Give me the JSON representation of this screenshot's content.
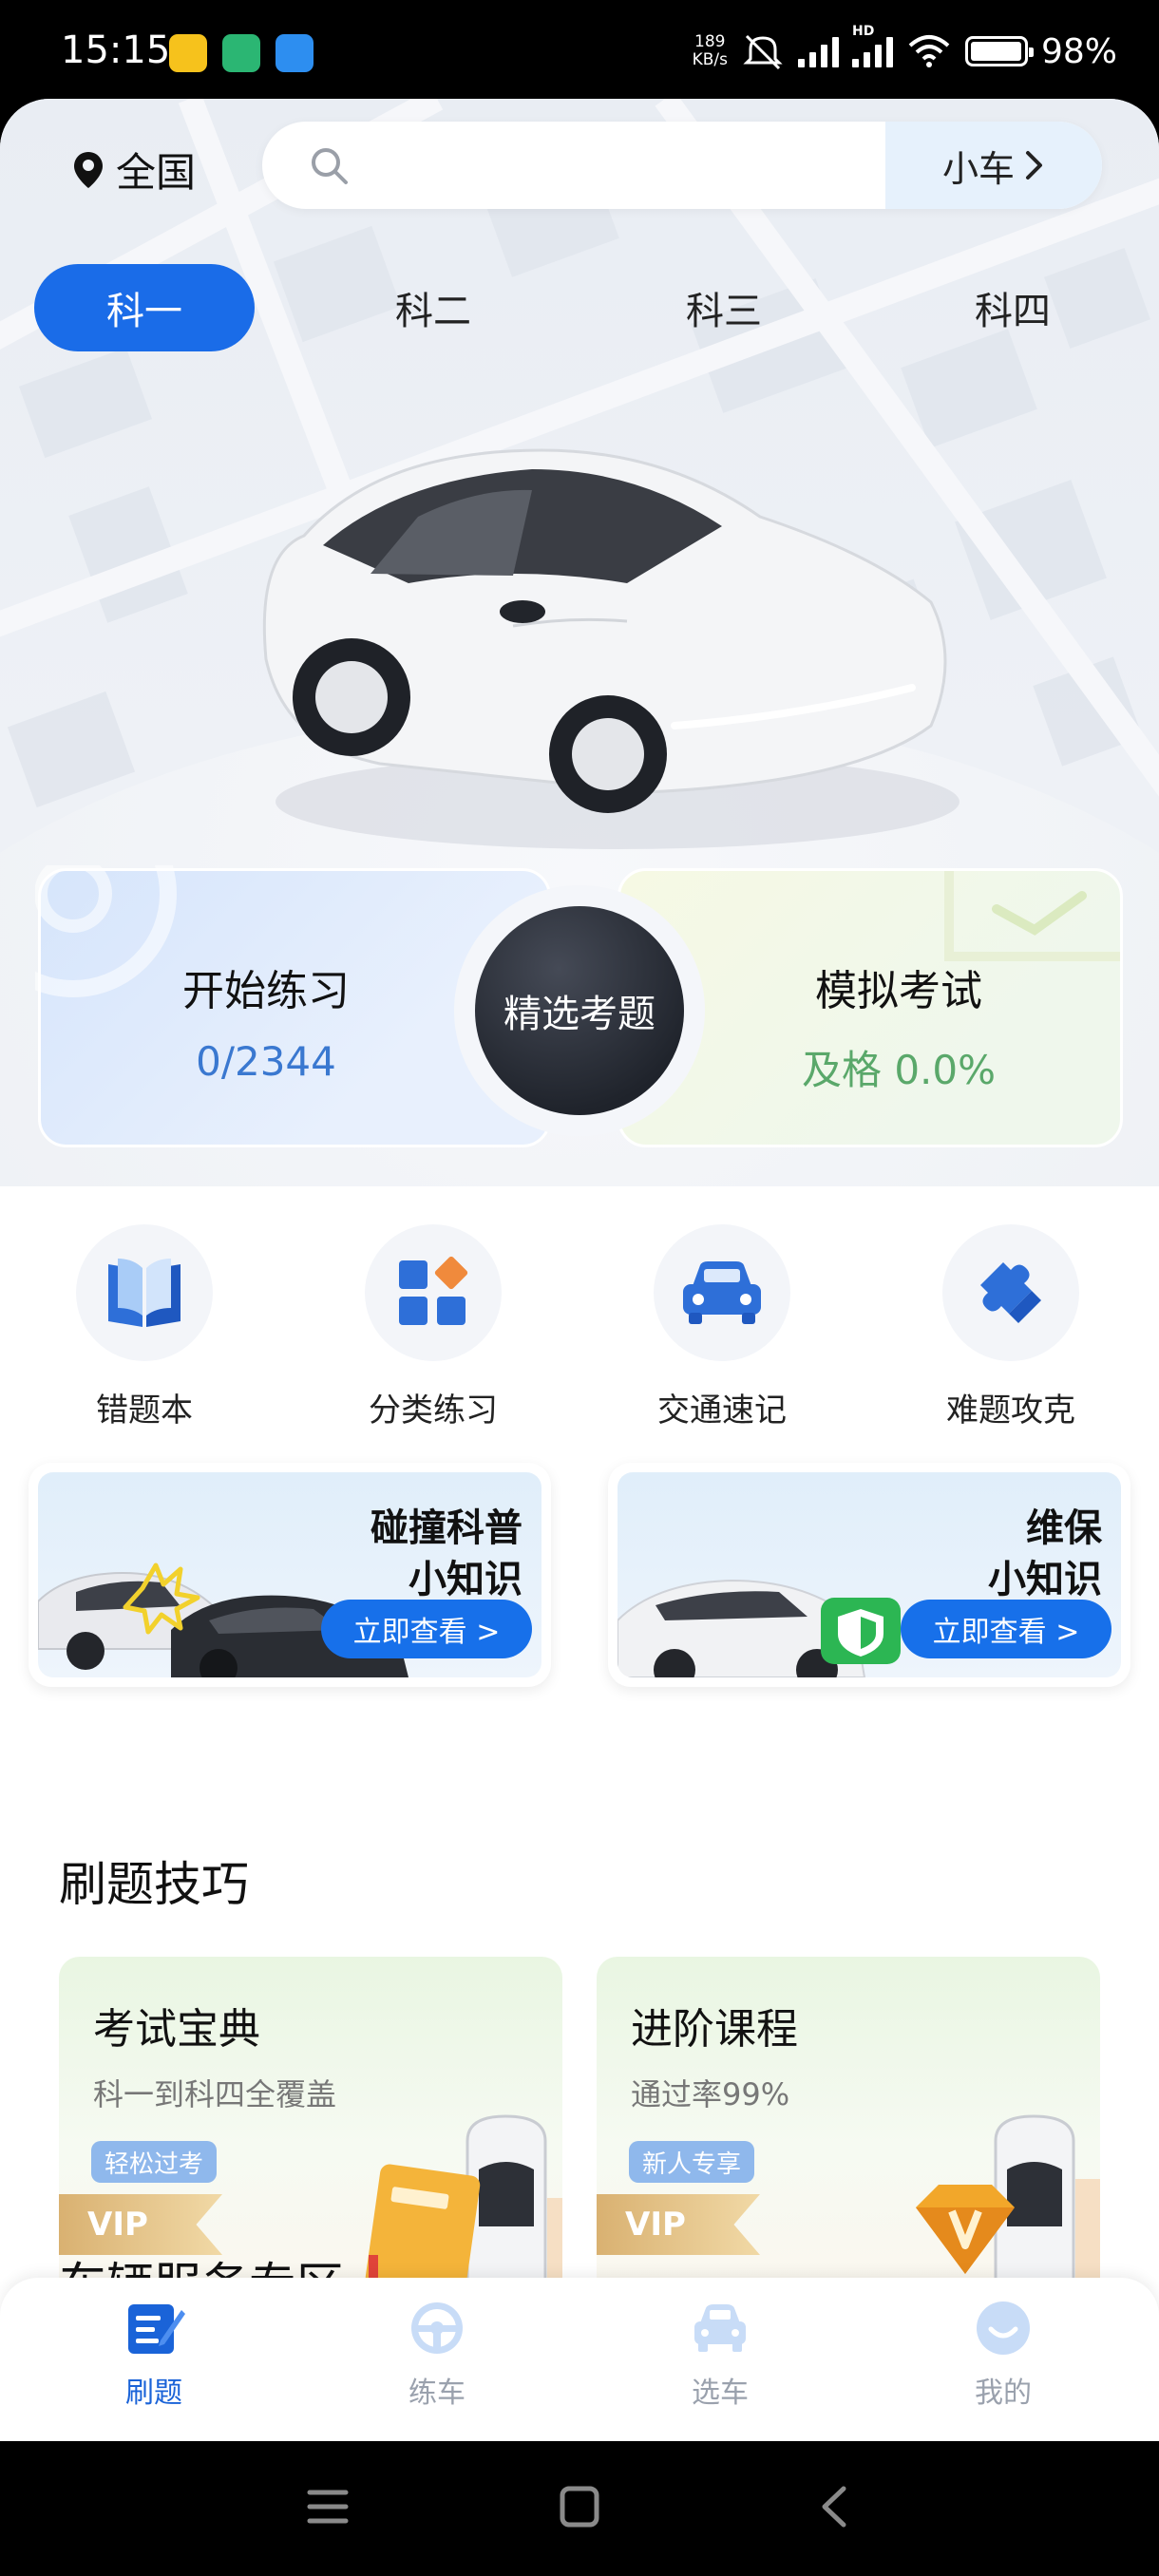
{
  "status_bar": {
    "time": "15:15",
    "net_speed_value": "189",
    "net_speed_unit": "KB/s",
    "hd_label": "HD",
    "battery": "98%",
    "battery_level": 0.98
  },
  "header": {
    "location": "全国",
    "search_placeholder": "",
    "car_type": "小车"
  },
  "subject_tabs": [
    "科一",
    "科二",
    "科三",
    "科四"
  ],
  "active_tab_index": 0,
  "practice_card": {
    "title": "开始练习",
    "progress": "0/2344"
  },
  "featured_button": {
    "label": "精选考题"
  },
  "exam_card": {
    "title": "模拟考试",
    "pass_rate": "及格 0.0%"
  },
  "quick_entries": [
    {
      "label": "错题本",
      "icon": "book-icon"
    },
    {
      "label": "分类练习",
      "icon": "category-icon"
    },
    {
      "label": "交通速记",
      "icon": "car-front-icon"
    },
    {
      "label": "难题攻克",
      "icon": "puzzle-icon"
    }
  ],
  "banners": [
    {
      "line1": "碰撞科普",
      "line2": "小知识",
      "button": "立即查看 >"
    },
    {
      "line1": "维保",
      "line2": "小知识",
      "button": "立即查看 >"
    }
  ],
  "tips_section": {
    "title": "刷题技巧",
    "cards": [
      {
        "title": "考试宝典",
        "subtitle": "科一到科四全覆盖",
        "badge": "轻松过考",
        "vip": "VIP"
      },
      {
        "title": "进阶课程",
        "subtitle": "通过率99%",
        "badge": "新人专享",
        "vip": "VIP"
      }
    ]
  },
  "next_section_title": "车辆服务专区",
  "bottom_nav": [
    {
      "label": "刷题",
      "icon": "exercise-icon"
    },
    {
      "label": "练车",
      "icon": "steering-wheel-icon"
    },
    {
      "label": "选车",
      "icon": "car-icon"
    },
    {
      "label": "我的",
      "icon": "profile-icon"
    }
  ],
  "active_nav_index": 0,
  "colors": {
    "primary": "#1a6ce8",
    "pass_green": "#5aa86a",
    "progress_blue": "#3a78d0",
    "nav_active": "#1a63d8",
    "nav_inactive": "#9aa1ad"
  }
}
